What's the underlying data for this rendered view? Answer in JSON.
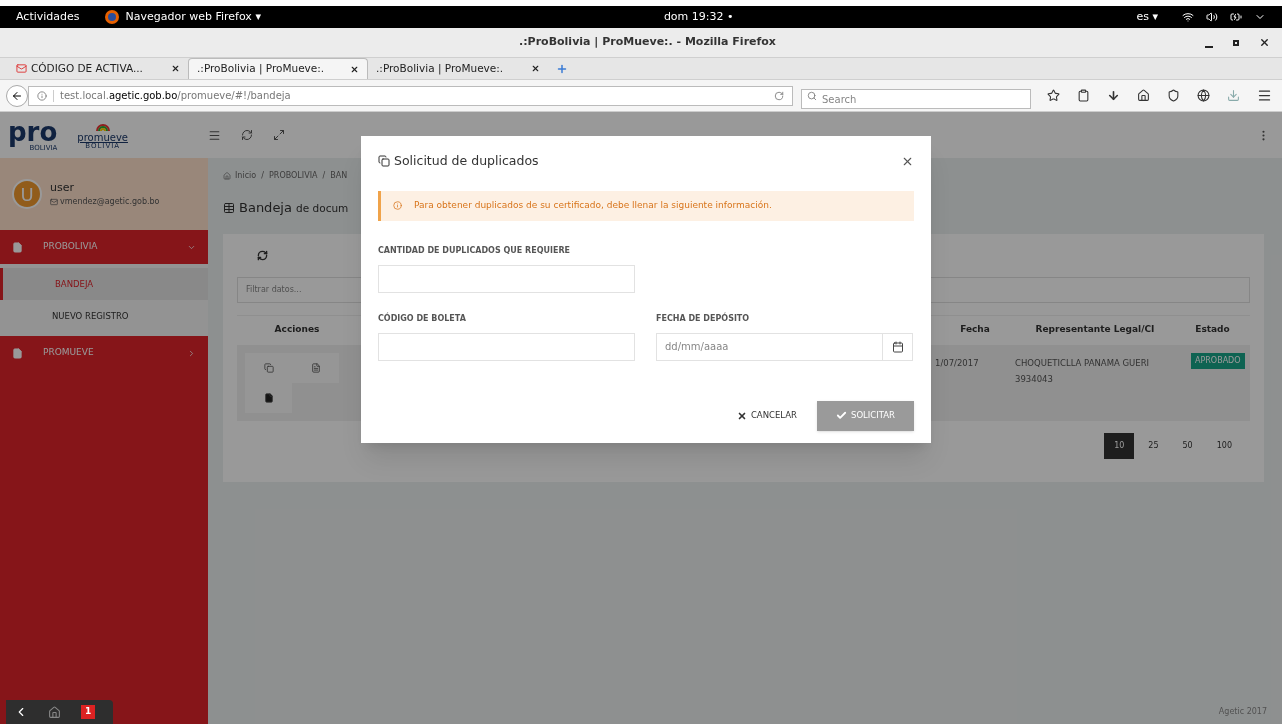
{
  "system_bar": {
    "activities": "Actividades",
    "app_menu": "Navegador web Firefox ▾",
    "clock": "dom 19:32",
    "clock_dot": "•",
    "lang": "es ▾"
  },
  "window": {
    "title": ".:ProBolivia | ProMueve:. - Mozilla Firefox"
  },
  "tabs": [
    {
      "label": "CÓDIGO DE ACTIVA...",
      "selected": false,
      "kind": "mail"
    },
    {
      "label": ".:ProBolivia | ProMueve:.",
      "selected": true,
      "kind": "page"
    },
    {
      "label": ".:ProBolivia | ProMueve:.",
      "selected": false,
      "kind": "page"
    }
  ],
  "address_bar": {
    "host_prefix": "test.local.",
    "host": "agetic.gob.bo",
    "path": "/promueve/#!/bandeja"
  },
  "search": {
    "placeholder": "Search"
  },
  "logos": {
    "pro": "pro",
    "pro_sub": "BOLIVIA",
    "promueve": "promueve",
    "promueve_sub": "BOLIVIA"
  },
  "user": {
    "initial": "U",
    "name": "user",
    "email": "vmendez@agetic.gob.bo"
  },
  "sidebar": {
    "items": [
      {
        "label": "PROBOLIVIA",
        "expanded": true,
        "children": [
          {
            "label": "BANDEJA",
            "selected": true
          },
          {
            "label": "NUEVO REGISTRO",
            "selected": false
          }
        ]
      },
      {
        "label": "PROMUEVE",
        "expanded": false
      }
    ]
  },
  "breadcrumb": "Inicio  /  PROBOLIVIA  /  BAN",
  "page_title": {
    "bold": "Bandeja",
    "rest": "de docum"
  },
  "filter": {
    "placeholder": "Filtrar datos..."
  },
  "table": {
    "columns": [
      "Acciones",
      "Fecha",
      "Representante Legal/CI",
      "Estado"
    ],
    "rows": [
      {
        "date": "1/07/2017",
        "representative": "CHOQUETICLLA PANAMA GUERI",
        "ci": "3934043",
        "status": "APROBADO"
      }
    ]
  },
  "pagination": [
    {
      "label": "10",
      "selected": true
    },
    {
      "label": "25",
      "selected": false
    },
    {
      "label": "50",
      "selected": false
    },
    {
      "label": "100",
      "selected": false
    }
  ],
  "footer": "Agetic 2017",
  "taskbar": {
    "badge": "1"
  },
  "modal": {
    "title": "Solicitud de duplicados",
    "alert": "Para obtener duplicados de su certificado, debe llenar la siguiente información.",
    "fields": [
      {
        "label": "CANTIDAD DE DUPLICADOS QUE REQUIERE",
        "kind": "text"
      },
      {
        "label": "CÓDIGO DE BOLETA",
        "kind": "text"
      },
      {
        "label": "FECHA DE DEPÓSITO",
        "kind": "date",
        "placeholder": "dd/mm/aaaa"
      }
    ],
    "cancel": "CANCELAR",
    "submit": "SOLICITAR"
  }
}
